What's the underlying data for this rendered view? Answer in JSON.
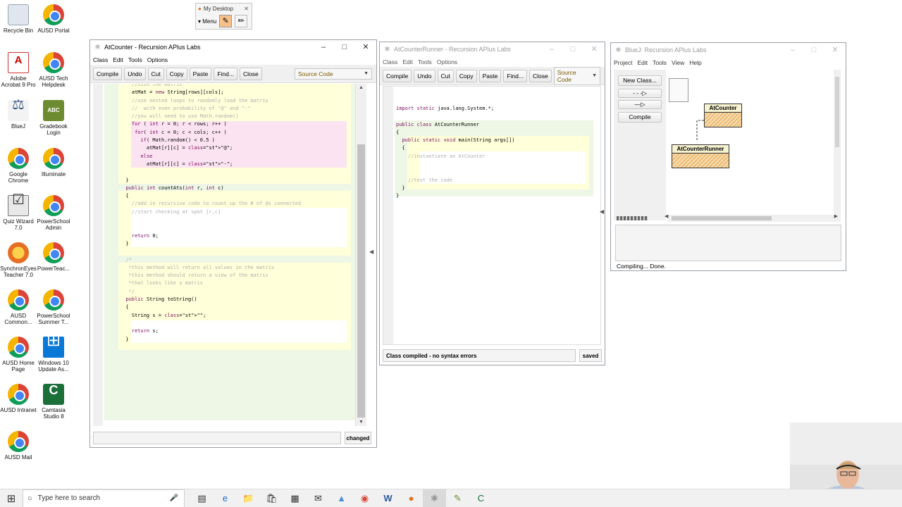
{
  "desktop": {
    "icons": [
      {
        "label": "Recycle Bin"
      },
      {
        "label": "AUSD Portal"
      },
      {
        "label": "Adobe Acrobat 9 Pro"
      },
      {
        "label": "AUSD Tech Helpdesk"
      },
      {
        "label": "BlueJ"
      },
      {
        "label": "Gradebook Login"
      },
      {
        "label": "Google Chrome"
      },
      {
        "label": "Illuminate"
      },
      {
        "label": "Quiz Wizard 7.0"
      },
      {
        "label": "PowerSchool Admin"
      },
      {
        "label": "SynchronEyes Teacher 7.0"
      },
      {
        "label": "PowerTeac..."
      },
      {
        "label": "AUSD Common..."
      },
      {
        "label": "PowerSchool Summer T..."
      },
      {
        "label": "AUSD Home Page"
      },
      {
        "label": "Windows 10 Update As..."
      },
      {
        "label": "AUSD Intranet"
      },
      {
        "label": "Camtasia Studio 8"
      },
      {
        "label": "AUSD Mail"
      }
    ],
    "mydesktop": {
      "title": "My Desktop",
      "menu": "Menu"
    }
  },
  "atcounter": {
    "title": "AtCounter - Recursion APlus Labs",
    "menus": [
      "Class",
      "Edit",
      "Tools",
      "Options"
    ],
    "toolbar": [
      "Compile",
      "Undo",
      "Cut",
      "Copy",
      "Paste",
      "Find...",
      "Close"
    ],
    "source_select": "Source Code",
    "code": [
      "    //size the matrix",
      "    atMat = new String[rows][cols];",
      "    //use nested loops to randomly load the matrix",
      "    //  with even probability of \"@\" and \"-\"",
      "    //you will need to use Math.random()",
      "    for ( int r = 0; r < rows; r++ )",
      "     for( int c = 0; c < cols; c++ )",
      "       if( Math.random() < 0.5 )",
      "         atMat[r][c] = \"@\";",
      "       else",
      "         atMat[r][c] = \"-\";",
      "",
      "  }",
      "  public int countAts(int r, int c)",
      "  {",
      "    //add in recursive code to count up the # of @s connected",
      "    //start checking at spot [r,c]",
      "",
      "",
      "    return 0;",
      "  }",
      "",
      "  /*",
      "   *this method will return all values in the matrix",
      "   *this method should return a view of the matrix",
      "   *that looks like a matrix",
      "   */",
      "  public String toString()",
      "  {",
      "    String s = \"\";",
      "",
      "    return s;",
      "  }"
    ],
    "status_text": "",
    "state": "changed"
  },
  "runner": {
    "title": "AtCounterRunner - Recursion APlus Labs",
    "menus": [
      "Class",
      "Edit",
      "Tools",
      "Options"
    ],
    "toolbar": [
      "Compile",
      "Undo",
      "Cut",
      "Copy",
      "Paste",
      "Find...",
      "Close"
    ],
    "source_select": "Source Code",
    "code": [
      "import static java.lang.System.*;",
      "",
      "public class AtCounterRunner",
      "{",
      "  public static void main(String args[])",
      "  {",
      "    //instantiate an AtCounter",
      "",
      "",
      "    //test the code",
      "  }",
      "}"
    ],
    "status_text": "Class compiled - no syntax errors",
    "state": "saved"
  },
  "bluej": {
    "title": "BlueJ: Recursion APlus Labs",
    "menus": [
      "Project",
      "Edit",
      "Tools",
      "View",
      "Help"
    ],
    "buttons": {
      "new_class": "New Class...",
      "compile": "Compile"
    },
    "classes": [
      "AtCounter",
      "AtCounterRunner"
    ],
    "status": "Compiling... Done."
  },
  "taskbar": {
    "search_placeholder": "Type here to search"
  },
  "colors": {
    "scope_green": "#eef7e6",
    "scope_yellow": "#ffffd9",
    "scope_pink": "#fbe3f2",
    "keyword": "#7a0d5e",
    "comment": "#b0b0b0"
  }
}
